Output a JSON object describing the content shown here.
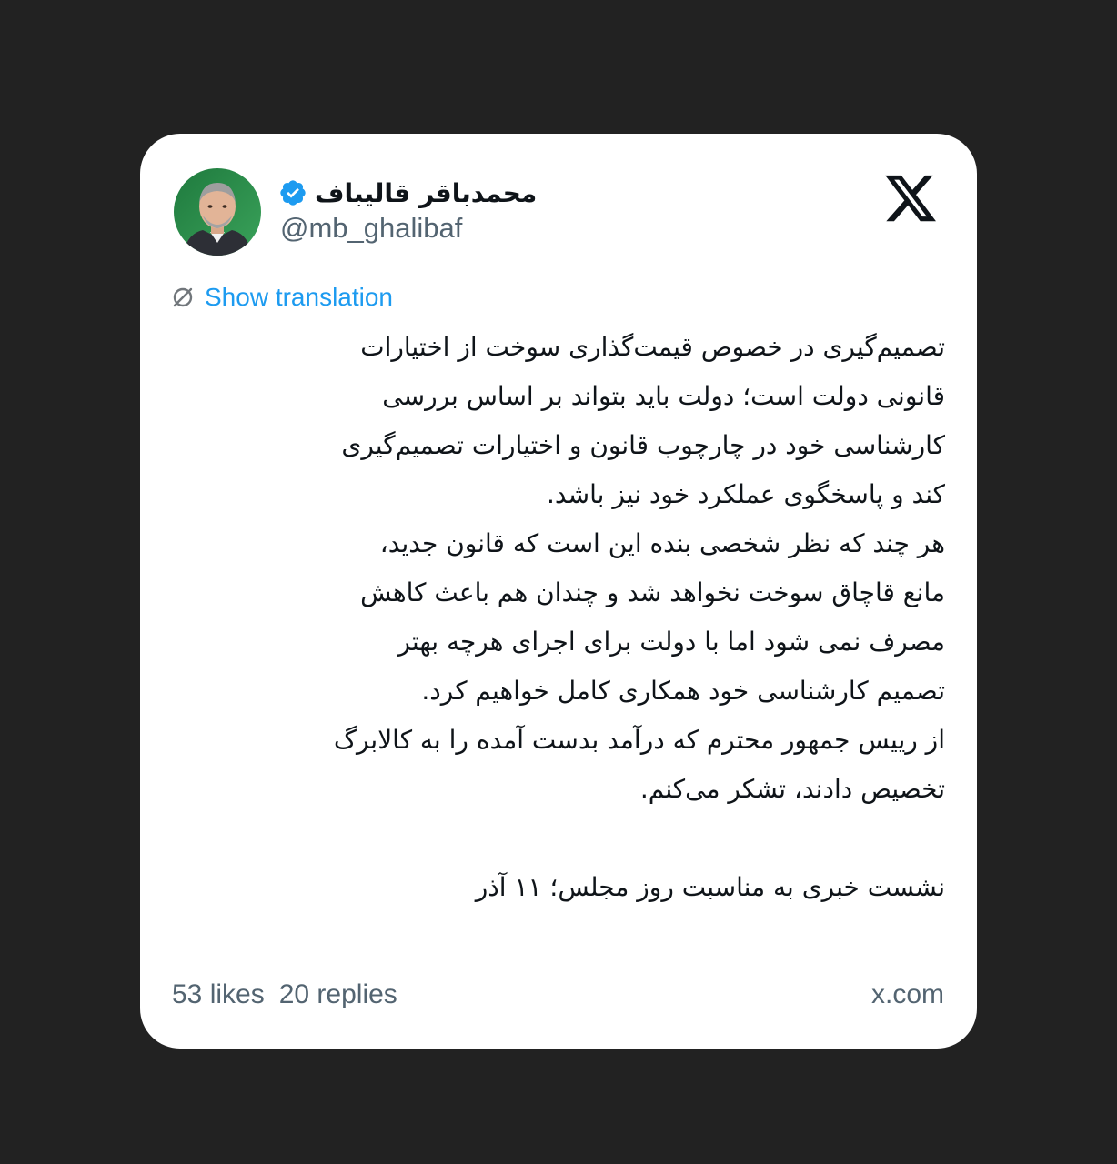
{
  "author": {
    "name": "محمدباقر قالیباف",
    "handle": "@mb_ghalibaf",
    "verified": true,
    "avatar_icon": "profile-photo"
  },
  "brand_icon": "x-logo",
  "translation": {
    "label": "Show translation",
    "icon": "translate-icon"
  },
  "tweet": {
    "lines": [
      "تصمیم‌گیری در خصوص قیمت‌گذاری سوخت از اختیارات",
      "قانونی دولت است؛ دولت باید بتواند بر اساس بررسی",
      "کارشناسی خود در چارچوب قانون و اختیارات تصمیم‌گیری",
      "کند و پاسخگوی عملکرد خود نیز باشد.",
      "هر چند که نظر شخصی بنده این است که قانون جدید،",
      "مانع قاچاق سوخت نخواهد شد و چندان هم باعث کاهش",
      "مصرف نمی شود اما با دولت برای اجرای هرچه بهتر",
      "تصمیم کارشناسی خود همکاری کامل خواهیم کرد.",
      "از رییس جمهور محترم که درآمد بدست آمده را به کالابرگ",
      "تخصیص دادند، تشکر می‌کنم.",
      "",
      "نشست خبری به مناسبت روز مجلس؛ ۱۱ آذر"
    ]
  },
  "stats": {
    "likes": "53 likes",
    "replies": "20 replies"
  },
  "source": "x.com",
  "colors": {
    "background": "#222222",
    "card": "#ffffff",
    "text": "#0f1419",
    "muted": "#536471",
    "accent": "#1d9bf0"
  }
}
